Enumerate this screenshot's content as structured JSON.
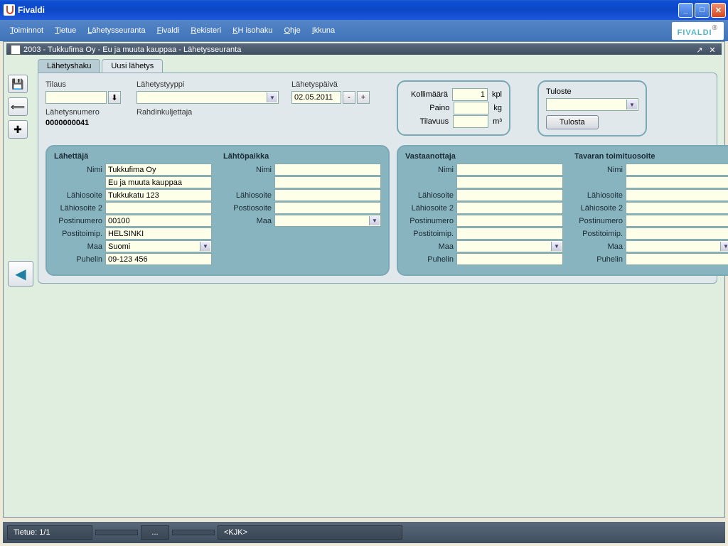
{
  "window": {
    "title": "Fivaldi"
  },
  "menu": {
    "items": [
      {
        "u": "T",
        "rest": "oiminnot"
      },
      {
        "u": "T",
        "rest": "ietue"
      },
      {
        "u": "L",
        "rest": "ähetysseuranta"
      },
      {
        "u": "F",
        "rest": "ivaldi"
      },
      {
        "u": "R",
        "rest": "ekisteri"
      },
      {
        "u": "K",
        "rest": "H isohaku"
      },
      {
        "u": "O",
        "rest": "hje"
      },
      {
        "u": "I",
        "rest": "kkuna"
      }
    ]
  },
  "brand": "FIVALDI",
  "subwindow": {
    "title": "2003 - Tukkufima Oy - Eu ja muuta kauppaa - Lähetysseuranta"
  },
  "tabs": {
    "search": "Lähetyshaku",
    "new": "Uusi lähetys"
  },
  "order": {
    "tilaus_label": "Tilaus",
    "tilaus_value": "",
    "lahetysnumero_label": "Lähetysnumero",
    "lahetysnumero_value": "0000000041",
    "tyyppi_label": "Lähetystyyppi",
    "tyyppi_value": "",
    "carrier_label": "Rahdinkuljettaja",
    "date_label": "Lähetyspäivä",
    "date_value": "02.05.2011"
  },
  "pkg": {
    "kolli_label": "Kollimäärä",
    "kolli_value": "1",
    "kolli_unit": "kpl",
    "paino_label": "Paino",
    "paino_value": "",
    "paino_unit": "kg",
    "tila_label": "Tilavuus",
    "tila_value": "",
    "tila_unit": "m³"
  },
  "print": {
    "header": "Tuloste",
    "btn": "Tulosta",
    "selection": ""
  },
  "sender": {
    "header": "Lähettäjä",
    "nimi_label": "Nimi",
    "nimi1": "Tukkufima Oy",
    "nimi2": "Eu ja muuta kauppaa",
    "lah_label": "Lähiosoite",
    "lah1": "Tukkukatu 123",
    "lah2_label": "Lähiosoite 2",
    "lah2": "",
    "pnro_label": "Postinumero",
    "pnro": "00100",
    "ptp_label": "Postitoimip.",
    "ptp": "HELSINKI",
    "maa_label": "Maa",
    "maa": "Suomi",
    "puh_label": "Puhelin",
    "puh": "09-123 456"
  },
  "origin": {
    "header": "Lähtöpaikka",
    "nimi_label": "Nimi",
    "nimi": "",
    "lah_label": "Lähiosoite",
    "lah": "",
    "post_label": "Postiosoite",
    "post": "",
    "maa_label": "Maa",
    "maa": ""
  },
  "recipient": {
    "header": "Vastaanottaja",
    "nimi_label": "Nimi",
    "nimi": "",
    "lah_label": "Lähiosoite",
    "lah": "",
    "lah2_label": "Lähiosoite 2",
    "lah2": "",
    "pnro_label": "Postinumero",
    "pnro": "",
    "ptp_label": "Postitoimip.",
    "ptp": "",
    "maa_label": "Maa",
    "maa": "",
    "puh_label": "Puhelin",
    "puh": ""
  },
  "delivery": {
    "header": "Tavaran toimituosoite",
    "nimi_label": "Nimi",
    "nimi": "",
    "lah_label": "Lähiosoite",
    "lah": "",
    "lah2_label": "Lähiosoite 2",
    "lah2": "",
    "pnro_label": "Postinumero",
    "pnro": "",
    "ptp_label": "Postitoimip.",
    "ptp": "",
    "maa_label": "Maa",
    "maa": "",
    "puh_label": "Puhelin",
    "puh": ""
  },
  "status": {
    "record": "Tietue: 1/1",
    "mid": "...",
    "user": "<KJK>"
  }
}
